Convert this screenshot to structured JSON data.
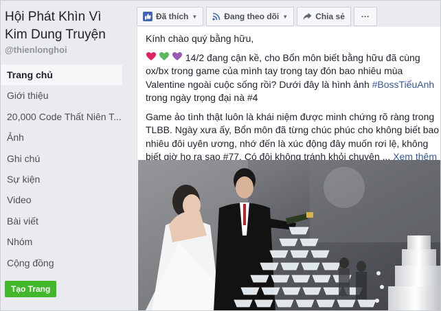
{
  "sidebar": {
    "page_name": "Hội Phát Khìn Vì Kim Dung Truyện",
    "handle": "@thienlonghoi",
    "nav_items": [
      {
        "label": "Trang chủ",
        "active": true
      },
      {
        "label": "Giới thiệu"
      },
      {
        "label": "20,000 Code Thất Niên T..."
      },
      {
        "label": "Ảnh"
      },
      {
        "label": "Ghi chú"
      },
      {
        "label": "Sự kiện"
      },
      {
        "label": "Video"
      },
      {
        "label": "Bài viết"
      },
      {
        "label": "Nhóm"
      },
      {
        "label": "Cộng đồng"
      }
    ],
    "create_page_label": "Tạo Trang"
  },
  "action_bar": {
    "liked_label": "Đã thích",
    "following_label": "Đang theo dõi",
    "share_label": "Chia sẻ",
    "more_label": "···"
  },
  "post": {
    "greeting": "Kính chào quý bằng hữu,",
    "para2_before": " 14/2 đang cận kề, cho Bổn môn biết bằng hữu đã cùng ox/bx trong game của mình tay trong tay đón bao nhiêu mùa Valentine ngoài cuộc sống rồi? Dưới đây là hình ảnh ",
    "hashtag": "#BossTiểuAnh",
    "para2_after": " trong ngày trọng đại nà #4",
    "para3": "Game ảo tình thật luôn là khái niệm được minh chứng rõ ràng trong TLBB. Ngày xưa ấy, Bổn môn đã từng chúc phúc cho không biết bao nhiêu đôi uyên ương, nhớ đến là xúc động đây muốn rơi lệ, không biết giờ họ ra sao #77. Có đôi không tránh khỏi chuyện ... ",
    "see_more": "Xem thêm"
  },
  "colors": {
    "brand_blue": "#4267b2",
    "link": "#365899",
    "create_green": "#42b72a",
    "heart_red": "#e0245e",
    "heart_green": "#5cb85c",
    "heart_purple": "#9b59b6"
  }
}
